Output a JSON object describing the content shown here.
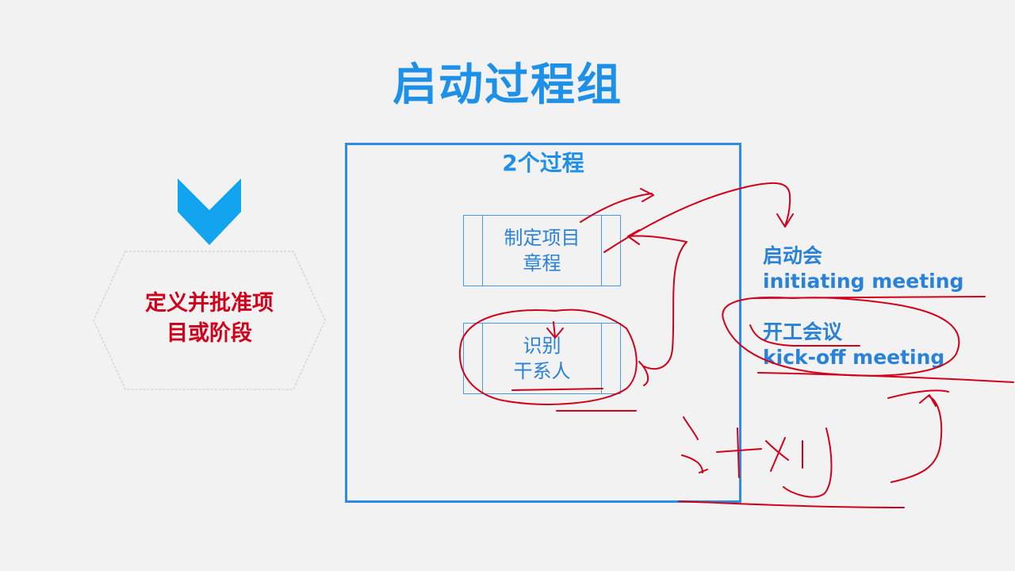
{
  "slide": {
    "title": "启动过程组",
    "left_hexagon_text_line1": "定义并批准项",
    "left_hexagon_text_line2": "目或阶段",
    "box_title": "2个过程",
    "processes": [
      {
        "line1": "制定项目",
        "line2": "章程"
      },
      {
        "line1": "识别",
        "line2": "干系人"
      }
    ],
    "notes": {
      "kickoff_cn": "启动会",
      "kickoff_en": "initiating meeting",
      "startup_cn": "开工会议",
      "startup_en": "kick-off meeting"
    },
    "colors": {
      "accent_blue": "#1e90e8",
      "hexagon_text_red": "#d0021b",
      "annotation_red": "#d0021b"
    }
  }
}
